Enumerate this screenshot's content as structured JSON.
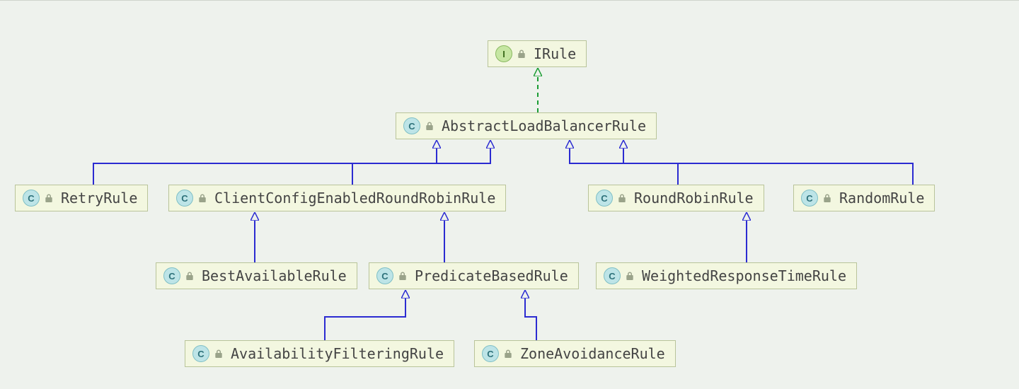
{
  "diagram": {
    "nodes": {
      "irule": {
        "kind": "interface",
        "label": "IRule"
      },
      "abstract": {
        "kind": "class",
        "label": "AbstractLoadBalancerRule"
      },
      "retry": {
        "kind": "class",
        "label": "RetryRule"
      },
      "clientconfig": {
        "kind": "class",
        "label": "ClientConfigEnabledRoundRobinRule"
      },
      "roundrobin": {
        "kind": "class",
        "label": "RoundRobinRule"
      },
      "random": {
        "kind": "class",
        "label": "RandomRule"
      },
      "bestavail": {
        "kind": "class",
        "label": "BestAvailableRule"
      },
      "predicate": {
        "kind": "class",
        "label": "PredicateBasedRule"
      },
      "weighted": {
        "kind": "class",
        "label": "WeightedResponseTimeRule"
      },
      "availfilter": {
        "kind": "class",
        "label": "AvailabilityFilteringRule"
      },
      "zoneavoid": {
        "kind": "class",
        "label": "ZoneAvoidanceRule"
      }
    },
    "edges": [
      {
        "from": "abstract",
        "to": "irule",
        "style": "implements"
      },
      {
        "from": "retry",
        "to": "abstract",
        "style": "extends"
      },
      {
        "from": "clientconfig",
        "to": "abstract",
        "style": "extends"
      },
      {
        "from": "roundrobin",
        "to": "abstract",
        "style": "extends"
      },
      {
        "from": "random",
        "to": "abstract",
        "style": "extends"
      },
      {
        "from": "bestavail",
        "to": "clientconfig",
        "style": "extends"
      },
      {
        "from": "predicate",
        "to": "clientconfig",
        "style": "extends"
      },
      {
        "from": "weighted",
        "to": "roundrobin",
        "style": "extends"
      },
      {
        "from": "availfilter",
        "to": "predicate",
        "style": "extends"
      },
      {
        "from": "zoneavoid",
        "to": "predicate",
        "style": "extends"
      }
    ],
    "icon_letters": {
      "interface": "I",
      "class": "C"
    }
  }
}
